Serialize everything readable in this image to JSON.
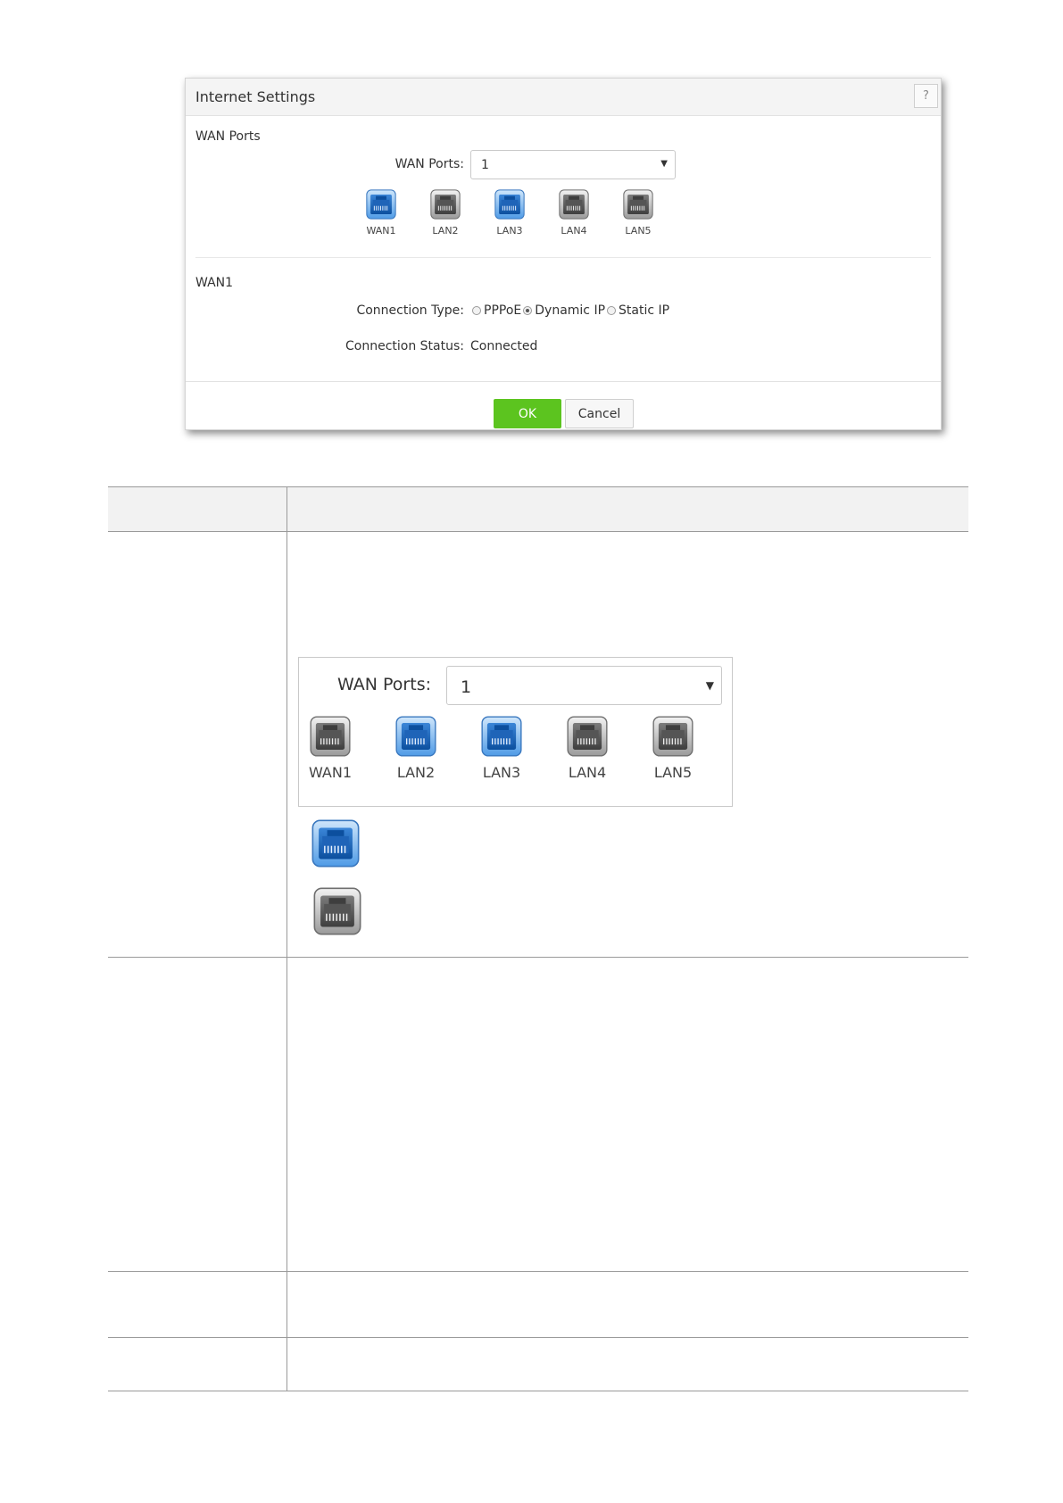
{
  "dialog": {
    "title": "Internet Settings",
    "help_label": "?",
    "wan_ports_section": "WAN Ports",
    "wan_ports_label": "WAN Ports:",
    "wan_ports_value": "1",
    "ports": [
      {
        "label": "WAN1",
        "state": "connected"
      },
      {
        "label": "LAN2",
        "state": "disconnected"
      },
      {
        "label": "LAN3",
        "state": "connected"
      },
      {
        "label": "LAN4",
        "state": "disconnected"
      },
      {
        "label": "LAN5",
        "state": "disconnected"
      }
    ],
    "wan1_section": "WAN1",
    "connection_type_label": "Connection Type:",
    "connection_types": [
      {
        "label": "PPPoE",
        "selected": false
      },
      {
        "label": "Dynamic IP",
        "selected": true
      },
      {
        "label": "Static IP",
        "selected": false
      }
    ],
    "connection_status_label": "Connection Status:",
    "connection_status_value": "Connected",
    "ok_label": "OK",
    "cancel_label": "Cancel"
  },
  "inset": {
    "wan_ports_label": "WAN Ports:",
    "wan_ports_value": "1",
    "ports": [
      {
        "label": "WAN1",
        "state": "disconnected"
      },
      {
        "label": "LAN2",
        "state": "connected"
      },
      {
        "label": "LAN3",
        "state": "connected"
      },
      {
        "label": "LAN4",
        "state": "disconnected"
      },
      {
        "label": "LAN5",
        "state": "disconnected"
      }
    ]
  },
  "legend": [
    {
      "state": "connected"
    },
    {
      "state": "disconnected"
    }
  ],
  "colors": {
    "connected_port": "#2f7fd6",
    "disconnected_port": "#6a6a6a",
    "ok_button": "#5cc41f"
  },
  "icons": {
    "port_connected": "ethernet-port-blue-icon",
    "port_disconnected": "ethernet-port-gray-icon",
    "select_arrow": "chevron-down-icon"
  }
}
